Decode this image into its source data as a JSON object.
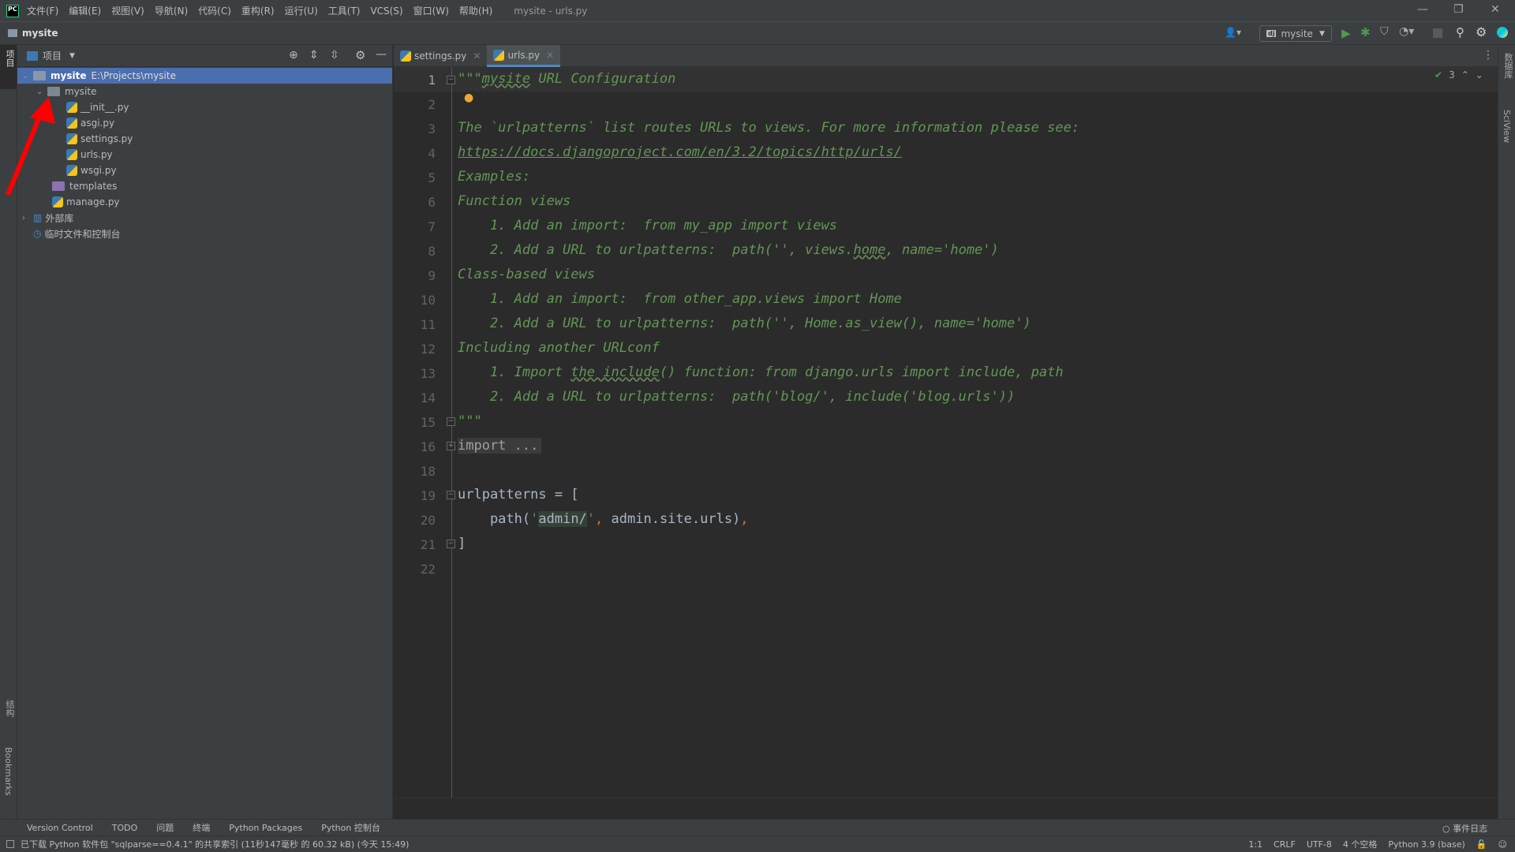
{
  "titlebar": {
    "logo": "PC",
    "menus": [
      "文件(F)",
      "编辑(E)",
      "视图(V)",
      "导航(N)",
      "代码(C)",
      "重构(R)",
      "运行(U)",
      "工具(T)",
      "VCS(S)",
      "窗口(W)",
      "帮助(H)"
    ],
    "title": "mysite - urls.py"
  },
  "navbar": {
    "breadcrumb": "mysite",
    "run_config": "mysite",
    "run_config_badge": "dj"
  },
  "project": {
    "header": "项目",
    "tree": [
      {
        "label": "mysite",
        "path": "E:\\Projects\\mysite",
        "level": 0,
        "type": "folder",
        "expanded": true,
        "selected": true
      },
      {
        "label": "mysite",
        "level": 1,
        "type": "package",
        "expanded": true
      },
      {
        "label": "__init__.py",
        "level": 2,
        "type": "python"
      },
      {
        "label": "asgi.py",
        "level": 2,
        "type": "python"
      },
      {
        "label": "settings.py",
        "level": 2,
        "type": "python"
      },
      {
        "label": "urls.py",
        "level": 2,
        "type": "python"
      },
      {
        "label": "wsgi.py",
        "level": 2,
        "type": "python"
      },
      {
        "label": "templates",
        "level": 1,
        "type": "templates-folder"
      },
      {
        "label": "manage.py",
        "level": 1,
        "type": "python"
      },
      {
        "label": "外部库",
        "level": 0,
        "type": "library",
        "expanded": false
      },
      {
        "label": "临时文件和控制台",
        "level": 0,
        "type": "scratches"
      }
    ]
  },
  "tabs": [
    {
      "label": "settings.py",
      "active": false
    },
    {
      "label": "urls.py",
      "active": true
    }
  ],
  "editor": {
    "inspection_count": "3",
    "lines": [
      {
        "n": "1"
      },
      {
        "n": "2"
      },
      {
        "n": "3"
      },
      {
        "n": "4"
      },
      {
        "n": "5"
      },
      {
        "n": "6"
      },
      {
        "n": "7"
      },
      {
        "n": "8"
      },
      {
        "n": "9"
      },
      {
        "n": "10"
      },
      {
        "n": "11"
      },
      {
        "n": "12"
      },
      {
        "n": "13"
      },
      {
        "n": "14"
      },
      {
        "n": "15"
      },
      {
        "n": "16"
      },
      {
        "n": "18"
      },
      {
        "n": "19"
      },
      {
        "n": "20"
      },
      {
        "n": "21"
      },
      {
        "n": "22"
      }
    ],
    "code": {
      "l1a": "\"\"\"",
      "l1b": "mysite",
      "l1c": " URL Configuration",
      "l3": "The `urlpatterns` list routes URLs to views. For more information please see:",
      "l4": "https://docs.djangoproject.com/en/3.2/topics/http/urls/",
      "l5": "Examples:",
      "l6": "Function views",
      "l7": "    1. Add an import:  from my_app import views",
      "l8a": "    2. Add a URL to urlpatterns:  path('', views.",
      "l8b": "home",
      "l8c": ", name='home')",
      "l9": "Class-based views",
      "l10": "    1. Add an import:  from other_app.views import Home",
      "l11": "    2. Add a URL to urlpatterns:  path('', Home.as_view(), name='home')",
      "l12": "Including another URLconf",
      "l13a": "    1. Import ",
      "l13b": "the include",
      "l13c": "() function: from django.urls import include, path",
      "l14": "    2. Add a URL to urlpatterns:  path('blog/', include('blog.urls'))",
      "l15": "\"\"\"",
      "l16": "import ...",
      "l19": "urlpatterns = [",
      "l20a": "    path(",
      "l20b": "'",
      "l20c": "admin/",
      "l20d": "'",
      ",": ",",
      "l20e": " admin.site.urls)",
      "l21": "]"
    }
  },
  "left_stripe": {
    "project": "项目",
    "structure": "结构",
    "bookmarks": "Bookmarks"
  },
  "right_stripe": {
    "database": "数据库",
    "sciview": "SciView"
  },
  "tool_windows": [
    "Version Control",
    "TODO",
    "问题",
    "终端",
    "Python Packages",
    "Python 控制台"
  ],
  "event_log": "事件日志",
  "status": {
    "message": "已下载 Python 软件包 \"sqlparse==0.4.1\" 的共享索引 (11秒147毫秒 的 60.32 kB) (今天 15:49)",
    "position": "1:1",
    "line_sep": "CRLF",
    "encoding": "UTF-8",
    "indent": "4 个空格",
    "interpreter": "Python 3.9 (base)"
  },
  "colors": {
    "selection": "#4b6eaf",
    "docstring": "#629755",
    "code": "#a9b7c6",
    "keyword": "#cc7832",
    "annotation_arrow": "#ff0000"
  }
}
